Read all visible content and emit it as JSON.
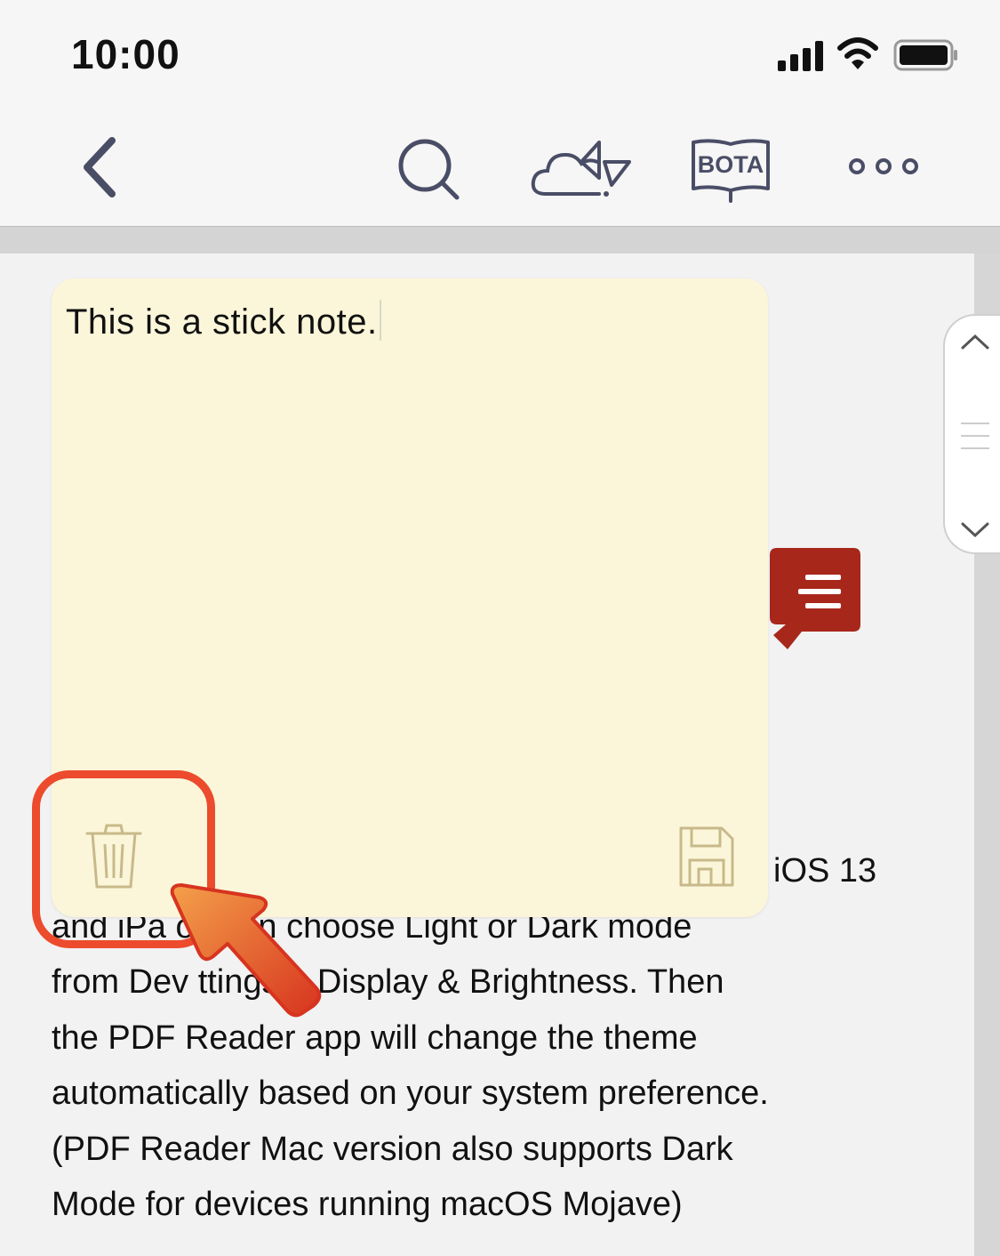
{
  "status_bar": {
    "time": "10:00",
    "icons": [
      "cellular-signal-icon",
      "wifi-icon",
      "battery-icon"
    ]
  },
  "toolbar": {
    "back": "chevron-left-icon",
    "search": "search-icon",
    "cloud_share": "cloud-share-icon",
    "bota_label": "BOTA",
    "more": "more-horizontal-icon"
  },
  "document": {
    "lines": [
      "iOS 13",
      "and iPa    ou can choose Light or Dark mode",
      "from Dev     ttings > Display & Brightness. Then",
      "the PDF Reader app will change the theme",
      "automatically based on your system preference.",
      "(PDF Reader Mac version also supports Dark",
      "Mode for devices running macOS Mojave)"
    ]
  },
  "sticky_note": {
    "text": "This is a stick note.",
    "delete_icon": "trash-icon",
    "save_icon": "floppy-disk-icon"
  },
  "colors": {
    "note_bg": "#fbf6d9",
    "note_icon": "#c8b98a",
    "highlight": "#ec4b2d",
    "comment_badge": "#a8271b",
    "toolbar_icon": "#4a4d66"
  }
}
